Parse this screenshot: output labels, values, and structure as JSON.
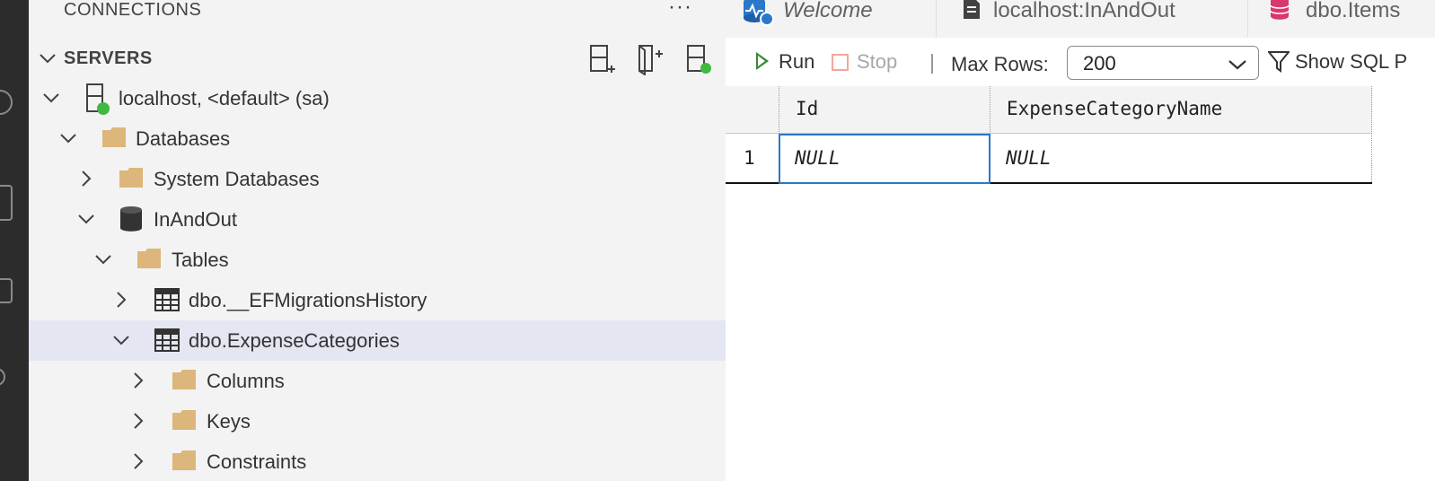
{
  "sidebar": {
    "title": "CONNECTIONS",
    "more": "···",
    "servers_label": "SERVERS",
    "header_buttons": [
      "new-connection-icon",
      "add-server-group-icon",
      "active-connections-icon"
    ],
    "tree": [
      {
        "label": "localhost, <default> (sa)",
        "icon": "server-icon",
        "expanded": true
      },
      {
        "label": "Databases",
        "icon": "folder-icon",
        "expanded": true
      },
      {
        "label": "System Databases",
        "icon": "folder-icon",
        "expanded": false
      },
      {
        "label": "InAndOut",
        "icon": "database-icon",
        "expanded": true
      },
      {
        "label": "Tables",
        "icon": "folder-icon",
        "expanded": true
      },
      {
        "label": "dbo.__EFMigrationsHistory",
        "icon": "table-icon",
        "expanded": false
      },
      {
        "label": "dbo.ExpenseCategories",
        "icon": "table-icon",
        "expanded": true,
        "selected": true
      },
      {
        "label": "Columns",
        "icon": "folder-icon",
        "expanded": false
      },
      {
        "label": "Keys",
        "icon": "folder-icon",
        "expanded": false
      },
      {
        "label": "Constraints",
        "icon": "folder-icon",
        "expanded": false
      }
    ]
  },
  "tabs": [
    {
      "label": "Welcome",
      "icon": "welcome-icon"
    },
    {
      "label": "localhost:InAndOut",
      "icon": "document-icon"
    },
    {
      "label": "dbo.Items",
      "icon": "database-icon"
    }
  ],
  "toolbar": {
    "run_label": "Run",
    "stop_label": "Stop",
    "max_rows_label": "Max Rows:",
    "max_rows_value": "200",
    "show_sql_label": "Show SQL P"
  },
  "grid": {
    "columns": [
      "Id",
      "ExpenseCategoryName"
    ],
    "rows": [
      {
        "num": "1",
        "cells": [
          "NULL",
          "NULL"
        ]
      }
    ]
  },
  "colors": {
    "accent": "#2a78c8",
    "run_green": "#388a34",
    "folder": "#dcb67a",
    "status_green": "#3fb93f",
    "selected_row": "#e4e6f1"
  }
}
